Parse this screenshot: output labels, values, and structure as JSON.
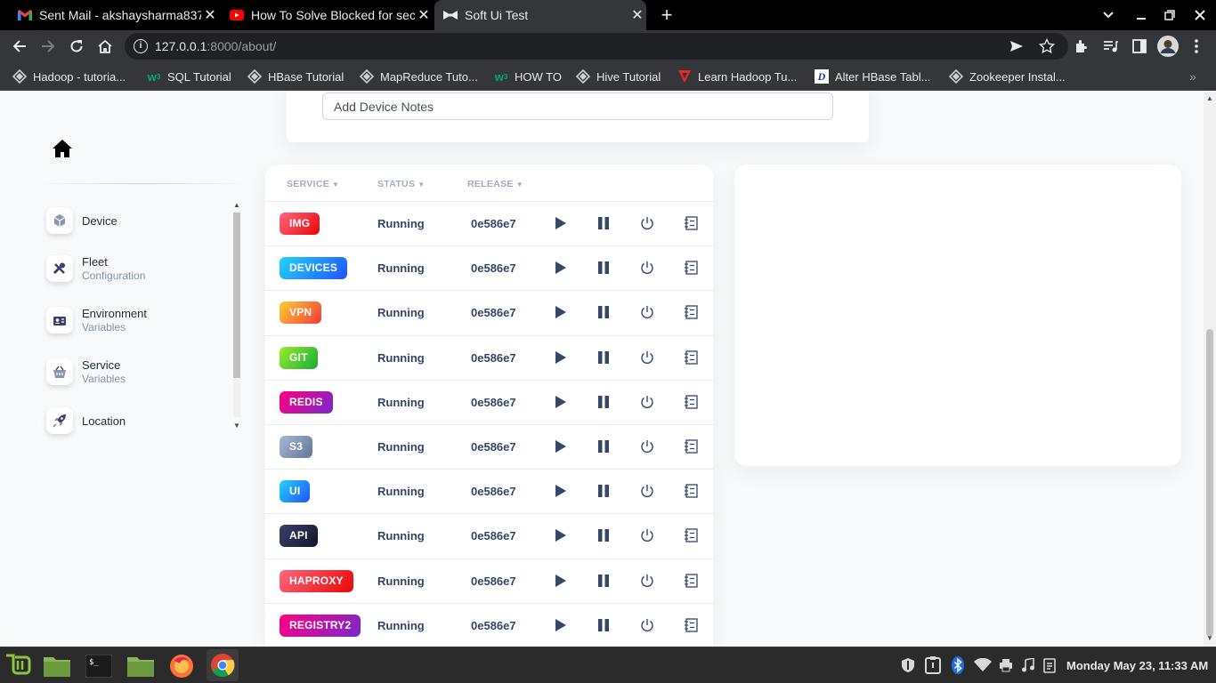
{
  "browser": {
    "tabs": [
      {
        "title": "Sent Mail - akshaysharma8378",
        "favicon": "gmail-icon",
        "active": false
      },
      {
        "title": "How To Solve Blocked for sec",
        "favicon": "youtube-icon",
        "active": false
      },
      {
        "title": "Soft Ui Test",
        "favicon": "bow-tie-icon",
        "active": true
      }
    ],
    "url_host": "127.0.0.1",
    "url_path": ":8000/about/",
    "bookmarks": [
      {
        "label": "Hadoop - tutoria...",
        "icon": "tutorial-icon"
      },
      {
        "label": "SQL Tutorial",
        "icon": "w3schools-icon"
      },
      {
        "label": "HBase Tutorial",
        "icon": "tutorial-icon"
      },
      {
        "label": "MapReduce Tuto...",
        "icon": "tutorial-icon"
      },
      {
        "label": "HOW TO",
        "icon": "w3schools-icon"
      },
      {
        "label": "Hive Tutorial",
        "icon": "tutorial-icon"
      },
      {
        "label": "Learn Hadoop Tu...",
        "icon": "guru99-icon"
      },
      {
        "label": "Alter HBase Tabl...",
        "icon": "d-icon"
      },
      {
        "label": "Zookeeper Instal...",
        "icon": "tutorial-icon"
      }
    ]
  },
  "device_card": {
    "notes_placeholder": "Add Device Notes"
  },
  "sidebar": {
    "items": [
      {
        "label": "Device",
        "sub": "",
        "icon": "cube-icon"
      },
      {
        "label": "Fleet",
        "sub": "Configuration",
        "icon": "tools-icon"
      },
      {
        "label": "Environment",
        "sub": "Variables",
        "icon": "id-card-icon"
      },
      {
        "label": "Service",
        "sub": "Variables",
        "icon": "basket-icon"
      },
      {
        "label": "Location",
        "sub": "",
        "icon": "rocket-icon"
      }
    ]
  },
  "table": {
    "headers": {
      "service": "SERVICE",
      "status": "STATUS",
      "release": "RELEASE"
    },
    "rows": [
      {
        "service": "IMG",
        "status": "Running",
        "release": "0e586e7",
        "color_from": "#ea0606",
        "color_to": "#ff667c"
      },
      {
        "service": "DEVICES",
        "status": "Running",
        "release": "0e586e7",
        "color_from": "#2152ff",
        "color_to": "#21d4fd"
      },
      {
        "service": "VPN",
        "status": "Running",
        "release": "0e586e7",
        "color_from": "#f53939",
        "color_to": "#fbcf33"
      },
      {
        "service": "GIT",
        "status": "Running",
        "release": "0e586e7",
        "color_from": "#17ad37",
        "color_to": "#98ec2d"
      },
      {
        "service": "REDIS",
        "status": "Running",
        "release": "0e586e7",
        "color_from": "#7928ca",
        "color_to": "#ff0080"
      },
      {
        "service": "S3",
        "status": "Running",
        "release": "0e586e7",
        "color_from": "#627594",
        "color_to": "#a8b8d8"
      },
      {
        "service": "UI",
        "status": "Running",
        "release": "0e586e7",
        "color_from": "#2152ff",
        "color_to": "#21d4fd"
      },
      {
        "service": "API",
        "status": "Running",
        "release": "0e586e7",
        "color_from": "#141727",
        "color_to": "#3a416f"
      },
      {
        "service": "HAPROXY",
        "status": "Running",
        "release": "0e586e7",
        "color_from": "#ea0606",
        "color_to": "#ff667c"
      },
      {
        "service": "REGISTRY2",
        "status": "Running",
        "release": "0e586e7",
        "color_from": "#7928ca",
        "color_to": "#ff0080"
      }
    ]
  },
  "taskbar": {
    "clock": "Monday May 23, 11:33 AM"
  }
}
